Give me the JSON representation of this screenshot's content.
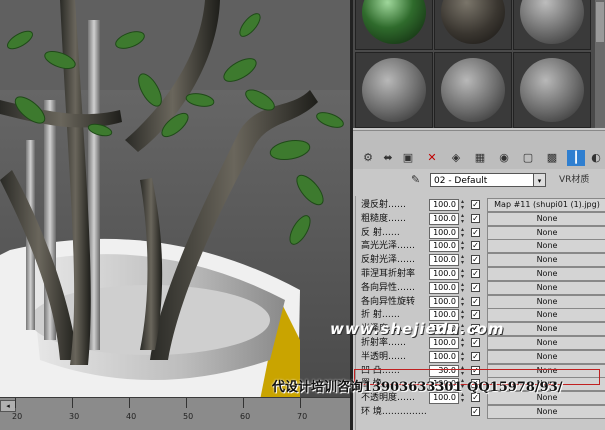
{
  "viewport": {
    "ruler_ticks": [
      "20",
      "30",
      "40",
      "50",
      "60",
      "70"
    ]
  },
  "toolbar": {
    "icons": [
      "get-material-icon",
      "put-to-scene-icon",
      "assign-icon",
      "reset-icon",
      "make-unique-icon",
      "put-to-library-icon",
      "material-effects-icon",
      "show-map-icon",
      "show-end-result-icon",
      "go-parent-icon"
    ]
  },
  "material": {
    "name": "02 - Default",
    "type_label": "VR材质"
  },
  "maps": {
    "rows": [
      {
        "label": "漫反射……",
        "value": "100.0",
        "checked": true,
        "map": "Map #11 (shupi01 (1).jpg)"
      },
      {
        "label": "粗糙度……",
        "value": "100.0",
        "checked": true,
        "map": "None"
      },
      {
        "label": "反 射……",
        "value": "100.0",
        "checked": true,
        "map": "None"
      },
      {
        "label": "高光光泽……",
        "value": "100.0",
        "checked": true,
        "map": "None"
      },
      {
        "label": "反射光泽……",
        "value": "100.0",
        "checked": true,
        "map": "None"
      },
      {
        "label": "菲涅耳折射率",
        "value": "100.0",
        "checked": true,
        "map": "None"
      },
      {
        "label": "各向异性……",
        "value": "100.0",
        "checked": true,
        "map": "None"
      },
      {
        "label": "各向异性旋转",
        "value": "100.0",
        "checked": true,
        "map": "None"
      },
      {
        "label": "折 射……",
        "value": "100.0",
        "checked": true,
        "map": "None"
      },
      {
        "label": "光泽度……",
        "value": "100.0",
        "checked": true,
        "map": "None"
      },
      {
        "label": "折射率……",
        "value": "100.0",
        "checked": true,
        "map": "None"
      },
      {
        "label": "半透明……",
        "value": "100.0",
        "checked": true,
        "map": "None"
      },
      {
        "label": "凹 凸……",
        "value": "30.0",
        "checked": true,
        "map": "None"
      },
      {
        "label": "置 换……",
        "value": "100.0",
        "checked": true,
        "map": "None"
      },
      {
        "label": "不透明度……",
        "value": "100.0",
        "checked": true,
        "map": "None"
      },
      {
        "label": "环 境……………",
        "value": "",
        "checked": true,
        "map": "None"
      }
    ]
  },
  "watermark": {
    "site": "www.shejiedu.com",
    "line": "代设计培训咨询13903633301 QQ15978/93/"
  },
  "colors": {
    "panel_bg": "#c8c8c8",
    "highlight": "#c02020"
  }
}
